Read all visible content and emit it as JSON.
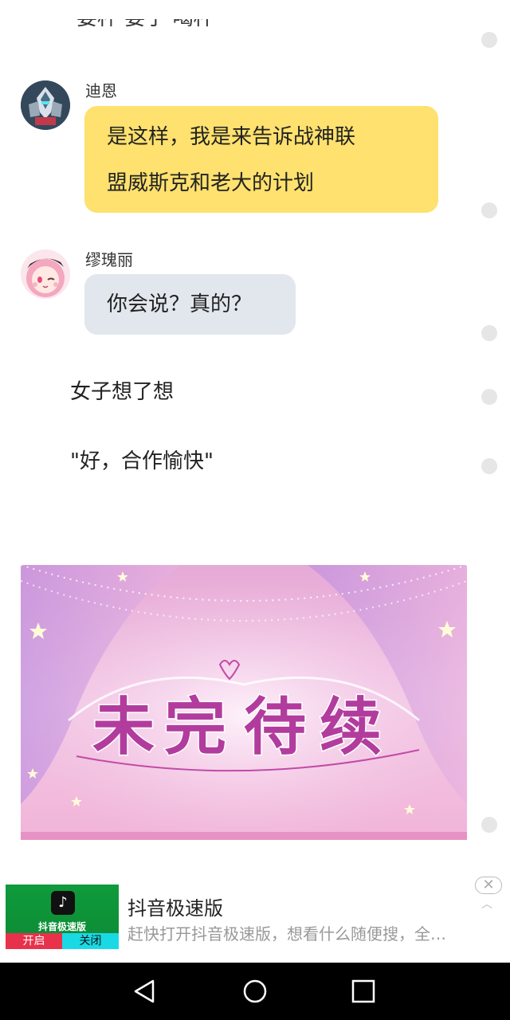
{
  "chat": {
    "previous_line_cut": "要杯 要子 喝杯",
    "messages": [
      {
        "speaker": "迪恩",
        "lines": [
          "是这样，我是来告诉战神联",
          "盟威斯克和老大的计划"
        ],
        "style": "yellow"
      },
      {
        "speaker": "缪瑰丽",
        "lines": [
          "你会说？真的？"
        ],
        "style": "gray"
      }
    ],
    "narration": [
      "女子想了想",
      "\"好，合作愉快\""
    ]
  },
  "banner": {
    "title_art": "未完待续"
  },
  "ad": {
    "thumb_title": "抖音极速版",
    "open_label": "开启",
    "close_label": "关闭",
    "title": "抖音极速版",
    "description": "赶快打开抖音极速版，想看什么随便搜，全…",
    "close_icon": "✕"
  },
  "colors": {
    "yellow_bubble": "#fee16e",
    "gray_bubble": "#e2e7ee",
    "nav_bar": "#000000"
  }
}
